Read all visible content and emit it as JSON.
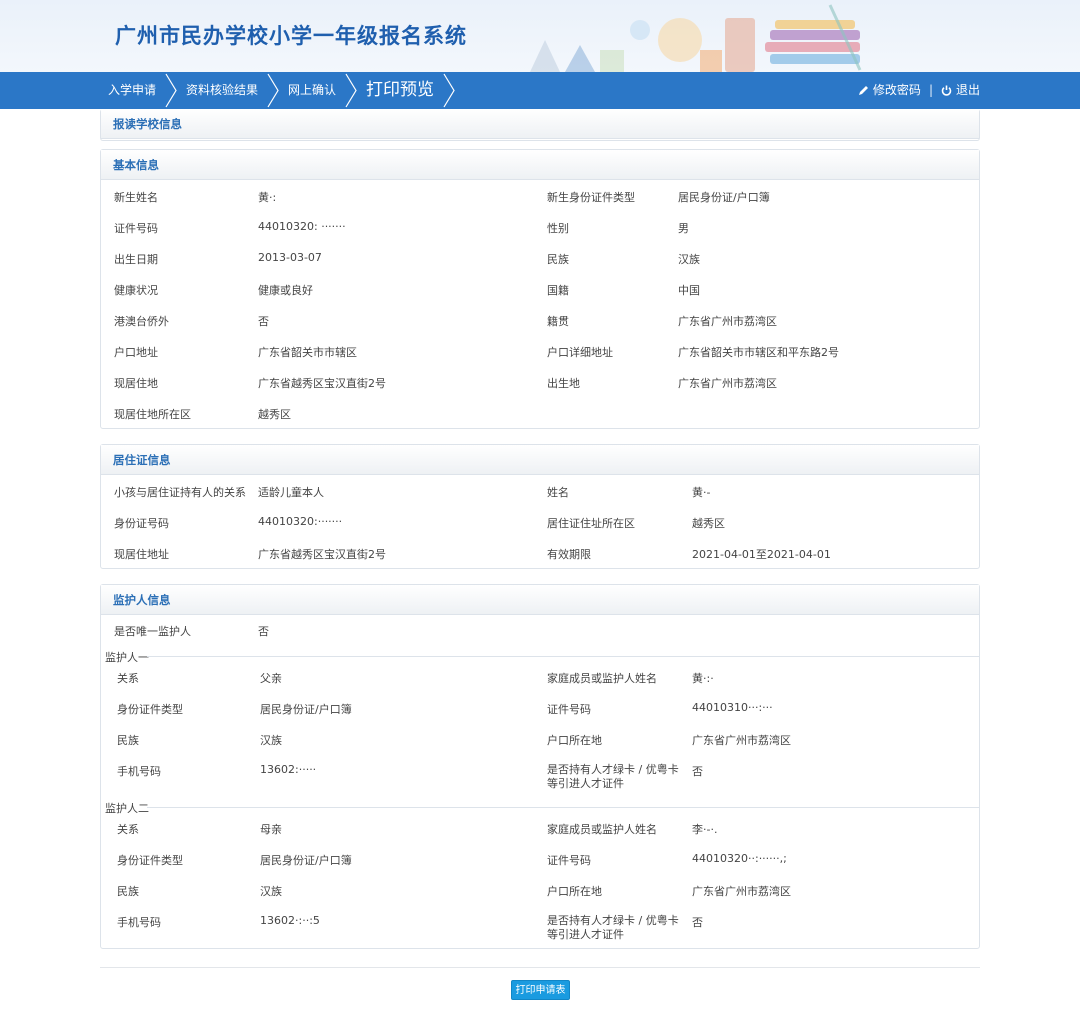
{
  "header": {
    "title": "广州市民办学校小学一年级报名系统"
  },
  "nav": {
    "steps": [
      "入学申请",
      "资料核验结果",
      "网上确认",
      "打印预览"
    ],
    "change_password": "修改密码",
    "separator": "|",
    "logout": "退出"
  },
  "school_panel": {
    "title": "报读学校信息"
  },
  "basic": {
    "title": "基本信息",
    "rows": [
      {
        "l1": "新生姓名",
        "v1": "黄·:",
        "l2": "新生身份证件类型",
        "v2": "居民身份证/户口簿"
      },
      {
        "l1": "证件号码",
        "v1": "44010320: ·······",
        "l2": "性别",
        "v2": "男"
      },
      {
        "l1": "出生日期",
        "v1": "2013-03-07",
        "l2": "民族",
        "v2": "汉族"
      },
      {
        "l1": "健康状况",
        "v1": "健康或良好",
        "l2": "国籍",
        "v2": "中国"
      },
      {
        "l1": "港澳台侨外",
        "v1": "否",
        "l2": "籍贯",
        "v2": "广东省广州市荔湾区"
      },
      {
        "l1": "户口地址",
        "v1": "广东省韶关市市辖区",
        "l2": "户口详细地址",
        "v2": "广东省韶关市市辖区和平东路2号"
      },
      {
        "l1": "现居住地",
        "v1": "广东省越秀区宝汉直街2号",
        "l2": "出生地",
        "v2": "广东省广州市荔湾区"
      },
      {
        "l1": "现居住地所在区",
        "v1": "越秀区",
        "l2": "",
        "v2": ""
      }
    ]
  },
  "residence": {
    "title": "居住证信息",
    "rows": [
      {
        "l1": "小孩与居住证持有人的关系",
        "v1": "适龄儿童本人",
        "l2": "姓名",
        "v2": "黄·-"
      },
      {
        "l1": "身份证号码",
        "v1": "44010320:·······",
        "l2": "居住证住址所在区",
        "v2": "越秀区"
      },
      {
        "l1": "现居住地址",
        "v1": "广东省越秀区宝汉直街2号",
        "l2": "有效期限",
        "v2": "2021-04-01至2021-04-01"
      }
    ]
  },
  "guardian": {
    "title": "监护人信息",
    "only_label": "是否唯一监护人",
    "only_value": "否",
    "guardians": [
      {
        "title": "监护人一",
        "rows": [
          {
            "l1": "关系",
            "v1": "父亲",
            "l2": "家庭成员或监护人姓名",
            "v2": "黄·:·"
          },
          {
            "l1": "身份证件类型",
            "v1": "居民身份证/户口簿",
            "l2": "证件号码",
            "v2": "44010310···:···"
          },
          {
            "l1": "民族",
            "v1": "汉族",
            "l2": "户口所在地",
            "v2": "广东省广州市荔湾区"
          },
          {
            "l1": "手机号码",
            "v1": "13602:·····",
            "l2": "是否持有人才绿卡 / 优粤卡等引进人才证件",
            "v2": "否"
          }
        ]
      },
      {
        "title": "监护人二",
        "rows": [
          {
            "l1": "关系",
            "v1": "母亲",
            "l2": "家庭成员或监护人姓名",
            "v2": "李·-·."
          },
          {
            "l1": "身份证件类型",
            "v1": "居民身份证/户口簿",
            "l2": "证件号码",
            "v2": "44010320··:······,;"
          },
          {
            "l1": "民族",
            "v1": "汉族",
            "l2": "户口所在地",
            "v2": "广东省广州市荔湾区"
          },
          {
            "l1": "手机号码",
            "v1": "13602·:··:5",
            "l2": "是否持有人才绿卡 / 优粤卡等引进人才证件",
            "v2": "否"
          }
        ]
      }
    ]
  },
  "footer": {
    "print_button": "打印申请表"
  },
  "colors": {
    "nav_bg": "#2b77c7",
    "title": "#1f5fae",
    "panel_title": "#2b6fb6",
    "button": "#1a9be0"
  }
}
